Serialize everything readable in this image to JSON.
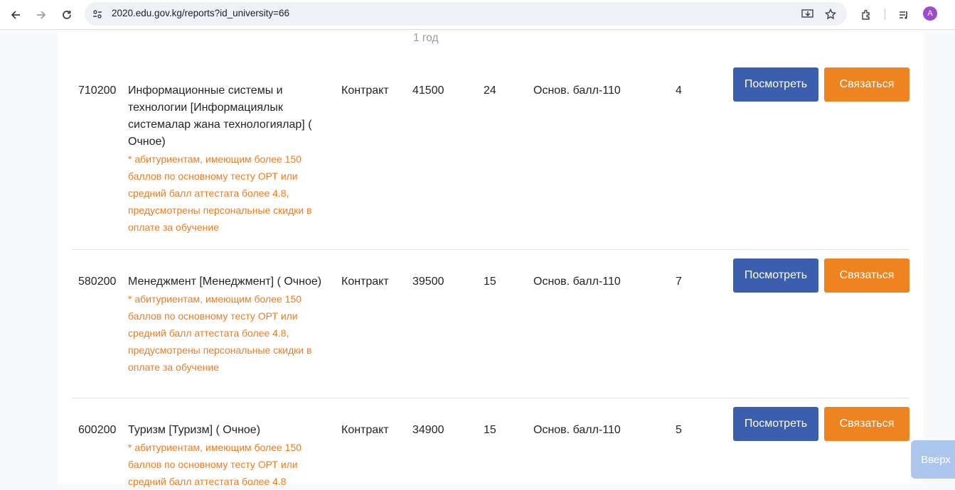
{
  "browser": {
    "url": "2020.edu.gov.kg/reports?id_university=66",
    "avatar_letter": "A"
  },
  "page": {
    "top_text": "1 год",
    "rows": [
      {
        "code": "710200",
        "name": "Информационные системы и технологии [Информациялык системалар жана технологиялар] ( Очное)",
        "note": "* абитуриентам, имеющим более 150 баллов по основному тесту ОРТ или средний балл аттестата более 4.8, предусмотрены персональные скидки в оплате за обучение",
        "type": "Контракт",
        "price": "41500",
        "seats": "24",
        "score": "Основ. балл-110",
        "count": "4"
      },
      {
        "code": "580200",
        "name": "Менеджмент [Менеджмент] ( Очное)",
        "note": "* абитуриентам, имеющим более 150 баллов по основному тесту ОРТ или средний балл аттестата более 4.8, предусмотрены персональные скидки в оплате за обучение",
        "type": "Контракт",
        "price": "39500",
        "seats": "15",
        "score": "Основ. балл-110",
        "count": "7"
      },
      {
        "code": "600200",
        "name": "Туризм [Туризм] ( Очное)",
        "note": "* абитуриентам, имеющим более 150 баллов по основному тесту ОРТ или средний балл аттестата более 4.8",
        "type": "Контракт",
        "price": "34900",
        "seats": "15",
        "score": "Основ. балл-110",
        "count": "5"
      }
    ],
    "view_label": "Посмотреть",
    "contact_label": "Связаться",
    "to_top_label": "Вверх"
  },
  "colors": {
    "view_button": "#3b5fae",
    "contact_button": "#ee8320",
    "note": "#f07b1f"
  }
}
